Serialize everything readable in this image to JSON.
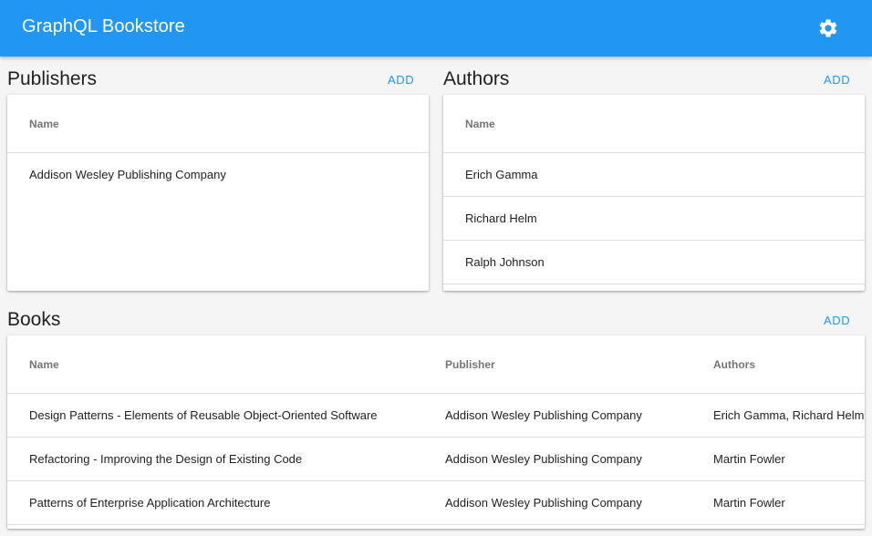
{
  "app": {
    "title": "GraphQL Bookstore",
    "settings_icon": "gear-icon",
    "accent": "#2196f3"
  },
  "publishers": {
    "title": "Publishers",
    "add_label": "ADD",
    "columns": [
      "Name"
    ],
    "rows": [
      {
        "name": "Addison Wesley Publishing Company"
      }
    ]
  },
  "authors": {
    "title": "Authors",
    "add_label": "ADD",
    "columns": [
      "Name"
    ],
    "rows": [
      {
        "name": "Erich Gamma"
      },
      {
        "name": "Richard Helm"
      },
      {
        "name": "Ralph Johnson"
      }
    ]
  },
  "books": {
    "title": "Books",
    "add_label": "ADD",
    "columns": [
      "Name",
      "Publisher",
      "Authors"
    ],
    "rows": [
      {
        "name": "Design Patterns - Elements of Reusable Object-Oriented Software",
        "publisher": "Addison Wesley Publishing Company",
        "authors": "Erich Gamma, Richard Helm,"
      },
      {
        "name": "Refactoring - Improving the Design of Existing Code",
        "publisher": "Addison Wesley Publishing Company",
        "authors": "Martin Fowler"
      },
      {
        "name": "Patterns of Enterprise Application Architecture",
        "publisher": "Addison Wesley Publishing Company",
        "authors": "Martin Fowler"
      }
    ]
  }
}
